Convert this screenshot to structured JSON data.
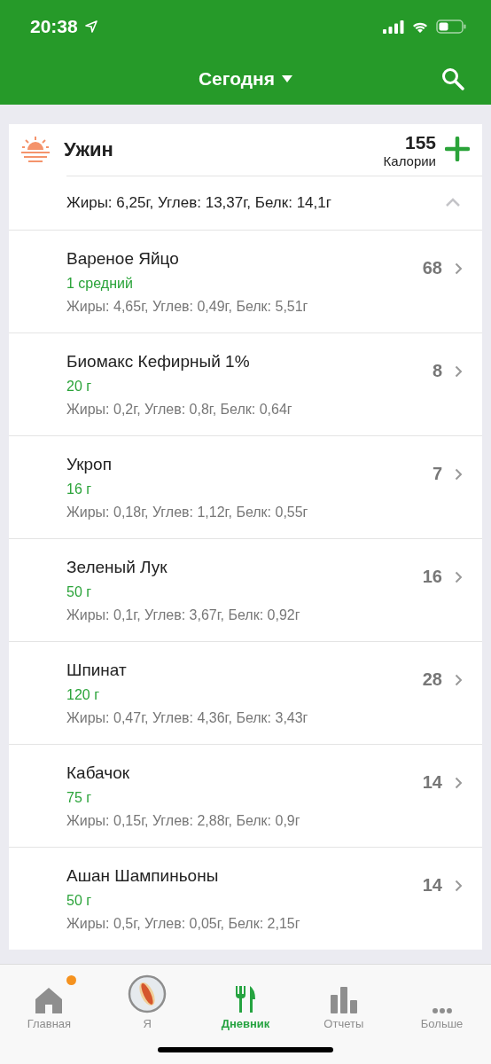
{
  "status_bar": {
    "time": "20:38"
  },
  "header": {
    "title": "Сегодня"
  },
  "meal": {
    "name": "Ужин",
    "calories": "155",
    "calories_label": "Калории",
    "macros": "Жиры: 6,25г, Углев: 13,37г, Белк: 14,1г",
    "expanded": true,
    "items": [
      {
        "name": "Вареное Яйцо",
        "portion": "1 средний",
        "macros": "Жиры: 4,65г, Углев: 0,49г, Белк: 5,51г",
        "calories": "68"
      },
      {
        "name": "Биомакс Кефирный 1%",
        "portion": "20 г",
        "macros": "Жиры: 0,2г, Углев: 0,8г, Белк: 0,64г",
        "calories": "8"
      },
      {
        "name": "Укроп",
        "portion": "16 г",
        "macros": "Жиры: 0,18г, Углев: 1,12г, Белк: 0,55г",
        "calories": "7"
      },
      {
        "name": "Зеленый Лук",
        "portion": "50 г",
        "macros": "Жиры: 0,1г, Углев: 3,67г, Белк: 0,92г",
        "calories": "16"
      },
      {
        "name": "Шпинат",
        "portion": "120 г",
        "macros": "Жиры: 0,47г, Углев: 4,36г, Белк: 3,43г",
        "calories": "28"
      },
      {
        "name": "Кабачок",
        "portion": "75 г",
        "macros": "Жиры: 0,15г, Углев: 2,88г, Белк: 0,9г",
        "calories": "14"
      },
      {
        "name": "Ашан Шампиньоны",
        "portion": "50 г",
        "macros": "Жиры: 0,5г, Углев: 0,05г, Белк: 2,15г",
        "calories": "14"
      }
    ]
  },
  "tabs": [
    {
      "kind": "home",
      "label": "Главная",
      "selected": false,
      "badge": true
    },
    {
      "kind": "me",
      "label": "Я",
      "selected": false,
      "badge": false
    },
    {
      "kind": "diary",
      "label": "Дневник",
      "selected": true,
      "badge": false
    },
    {
      "kind": "reports",
      "label": "Отчеты",
      "selected": false,
      "badge": false
    },
    {
      "kind": "more",
      "label": "Больше",
      "selected": false,
      "badge": false
    }
  ]
}
